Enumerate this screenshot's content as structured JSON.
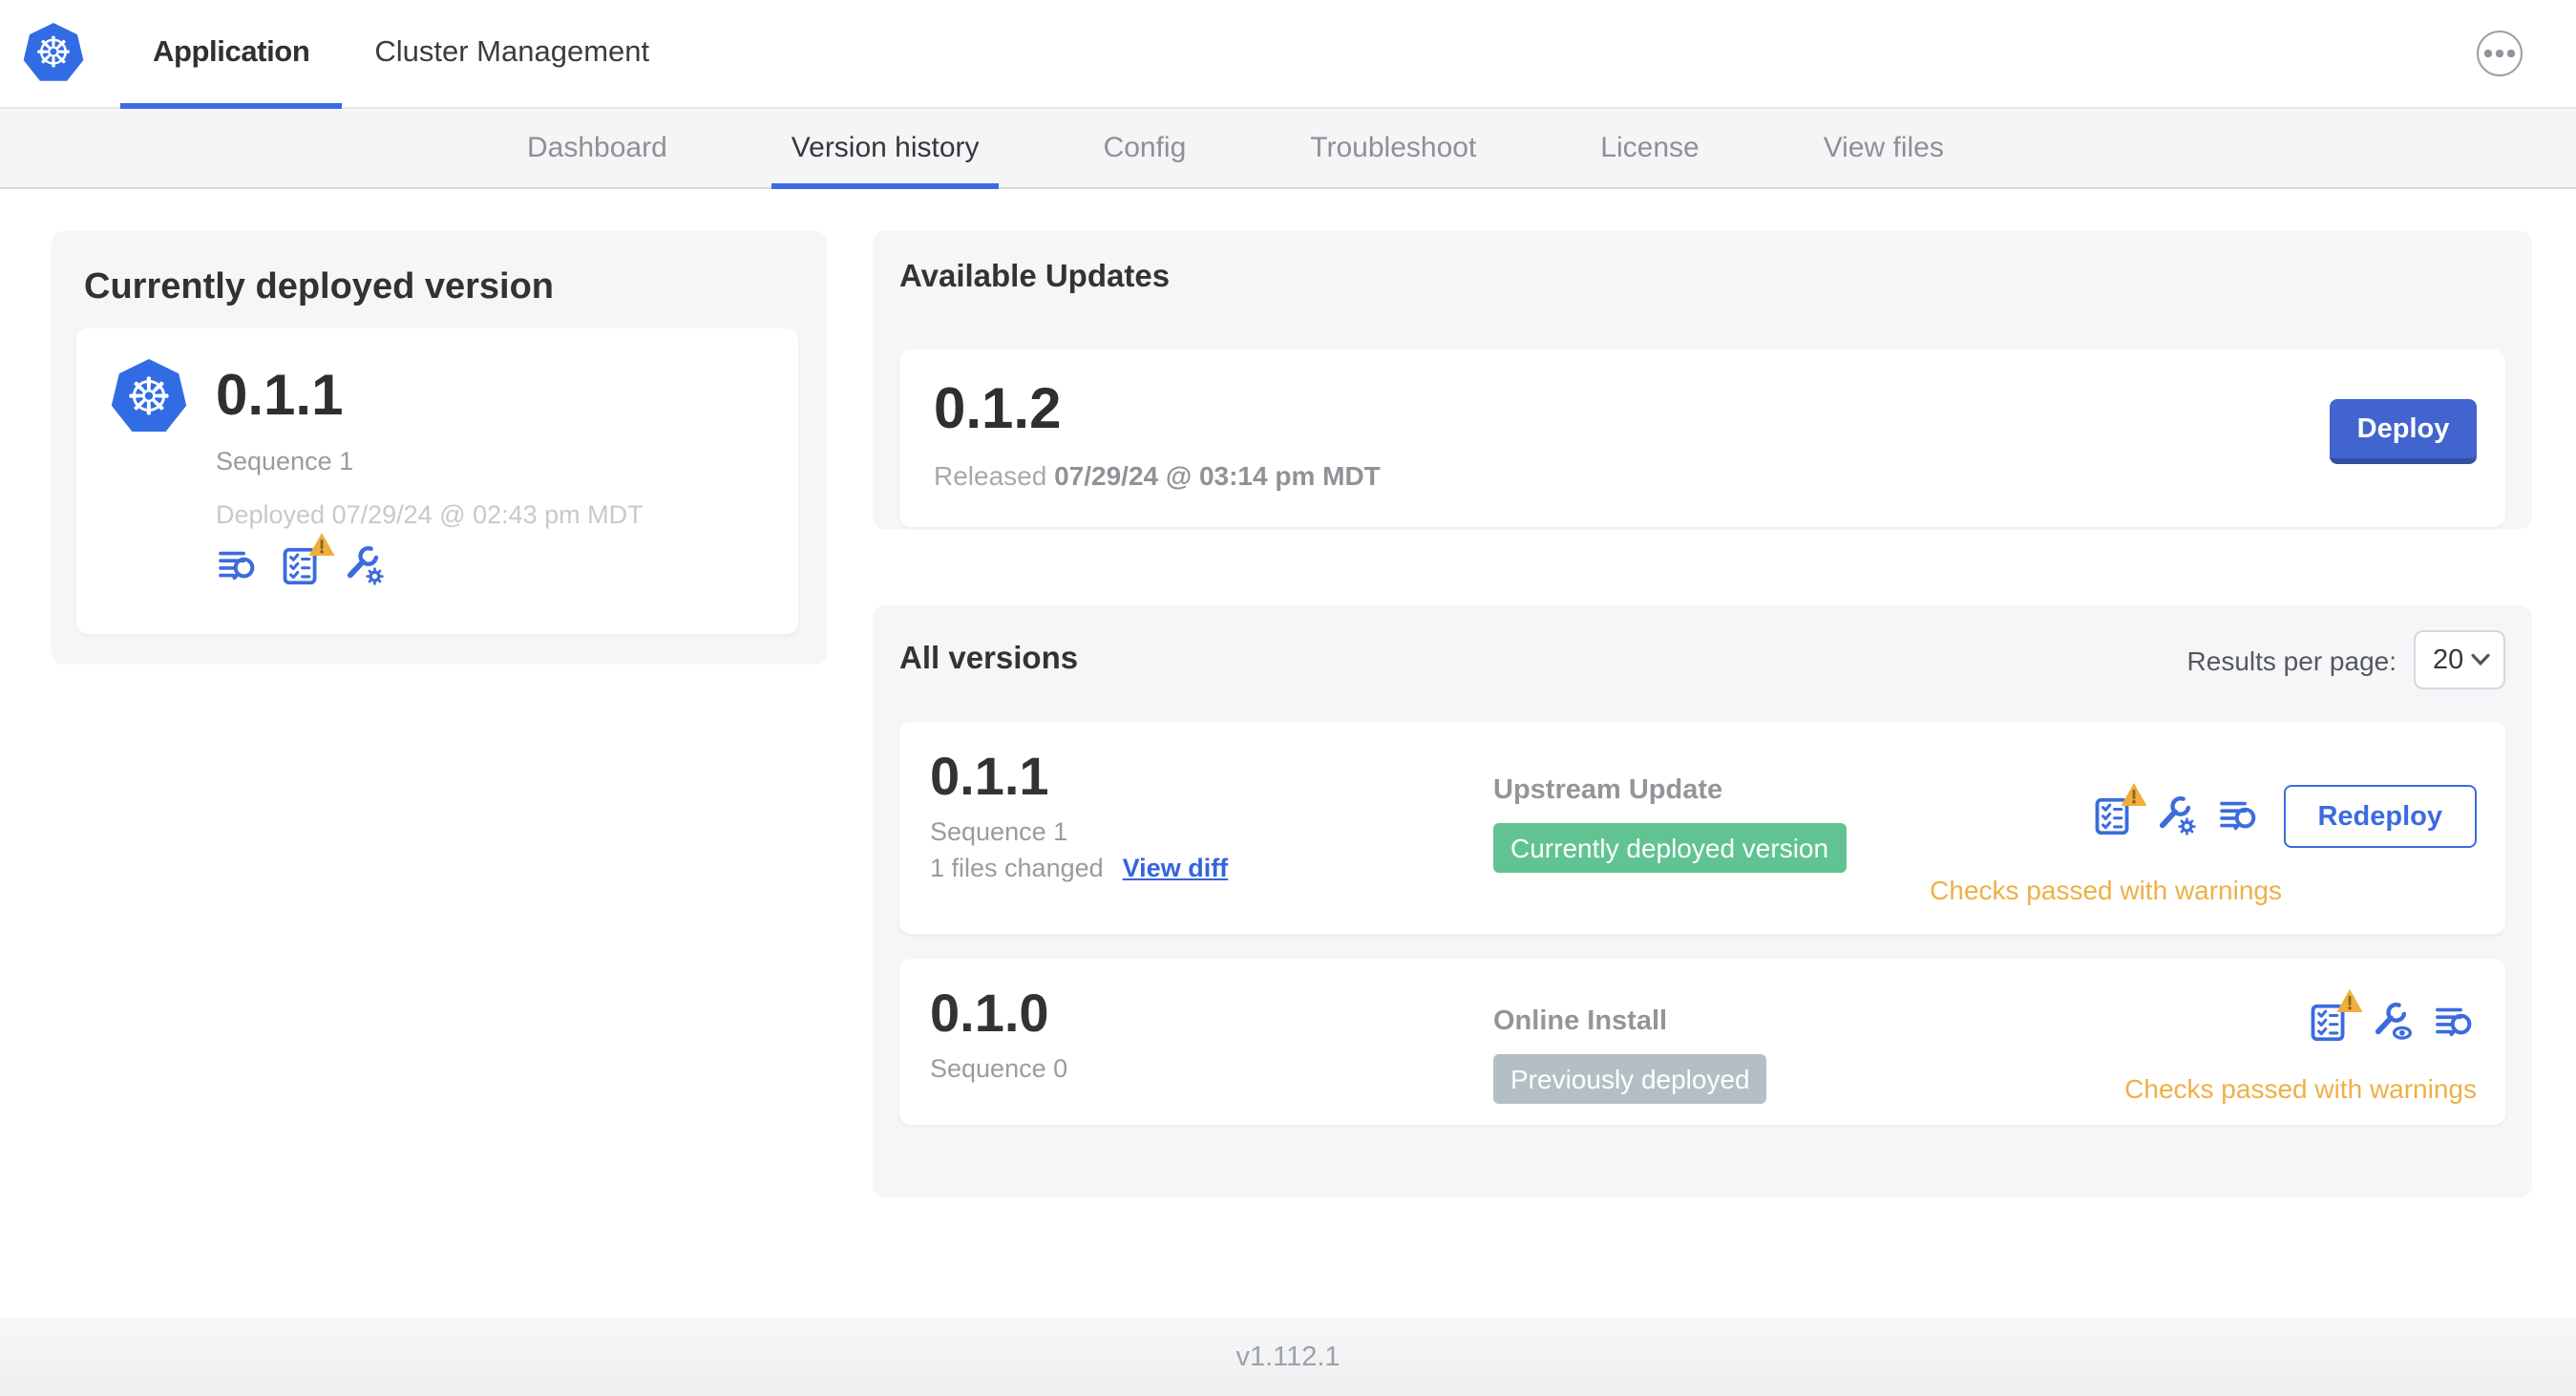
{
  "colors": {
    "accent_blue": "#3b6cde",
    "kubernetes_blue": "#326ce5",
    "deploy_button_blue": "#4164cf",
    "green_badge": "#61c392",
    "gray_badge": "#b3bfc5",
    "warning_amber": "#eeb045",
    "panel_background": "#f5f6f8"
  },
  "header": {
    "logo_icon": "kubernetes-helm-wheel-icon",
    "tabs": [
      {
        "label": "Application",
        "active": true
      },
      {
        "label": "Cluster Management",
        "active": false
      }
    ],
    "more_menu_icon": "ellipsis-icon"
  },
  "subnav": {
    "items": [
      {
        "label": "Dashboard",
        "active": false
      },
      {
        "label": "Version history",
        "active": true
      },
      {
        "label": "Config",
        "active": false
      },
      {
        "label": "Troubleshoot",
        "active": false
      },
      {
        "label": "License",
        "active": false
      },
      {
        "label": "View files",
        "active": false
      }
    ]
  },
  "current_version_card": {
    "title": "Currently deployed version",
    "version": "0.1.1",
    "sequence": "Sequence 1",
    "deployed": "Deployed 07/29/24 @ 02:43 pm MDT",
    "icons": [
      "release-notes-icon",
      "preflight-checks-warning-icon",
      "config-gear-icon"
    ]
  },
  "available_updates": {
    "title": "Available Updates",
    "version": "0.1.2",
    "released_prefix": "Released",
    "released_date": "07/29/24 @ 03:14 pm MDT",
    "deploy_label": "Deploy"
  },
  "all_versions": {
    "title": "All versions",
    "results_per_page_label": "Results per page:",
    "results_per_page_value": "20",
    "rows": [
      {
        "version": "0.1.1",
        "sequence": "Sequence 1",
        "files_changed": "1 files changed",
        "view_diff_label": "View diff",
        "source": "Upstream Update",
        "badge": "Currently deployed version",
        "badge_style": "green",
        "icons": [
          "preflight-checks-warning-icon",
          "config-gear-icon",
          "release-notes-icon"
        ],
        "action_label": "Redeploy",
        "status": "Checks passed with warnings"
      },
      {
        "version": "0.1.0",
        "sequence": "Sequence 0",
        "source": "Online Install",
        "badge": "Previously deployed",
        "badge_style": "gray",
        "icons": [
          "preflight-checks-warning-icon",
          "config-view-icon",
          "release-notes-icon"
        ],
        "status": "Checks passed with warnings"
      }
    ]
  },
  "footer": {
    "app_version": "v1.112.1"
  }
}
